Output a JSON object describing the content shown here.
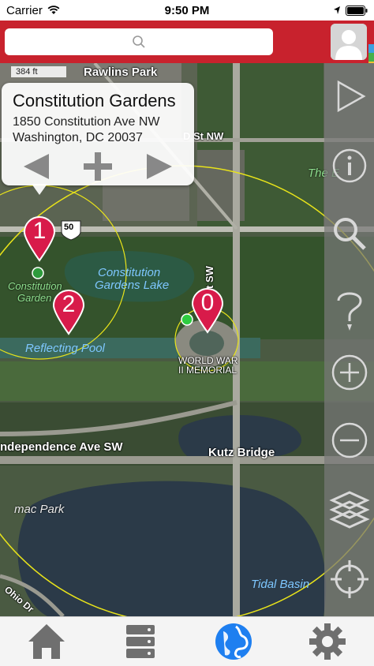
{
  "status_bar": {
    "carrier": "Carrier",
    "time": "9:50 PM"
  },
  "search": {
    "placeholder": ""
  },
  "map": {
    "scale_label": "384 ft",
    "labels": {
      "rawlins_park": "Rawlins Park",
      "d_st": "D St NW",
      "the_ellipse": "The E",
      "constitution_gardens_lake_1": "Constitution",
      "constitution_gardens_lake_2": "Gardens Lake",
      "constitution_garden_1": "Constitution",
      "constitution_garden_2": "Garden",
      "reflecting_pool": "Reflecting Pool",
      "seventeenth_st": "17th St SW",
      "wwii_1": "WORLD WAR",
      "wwii_2": "II MEMORIAL",
      "independence_ave": "ndependence Ave SW",
      "kutz_bridge": "Kutz Bridge",
      "potomac_park": "mac Park",
      "tidal_basin": "Tidal Basin",
      "ohio_dr": "Ohio Dr",
      "route_shield": "50"
    }
  },
  "info_card": {
    "title": "Constitution Gardens",
    "address_line1": "1850 Constitution Ave NW",
    "address_line2": "Washington, DC  20037"
  },
  "pins": [
    {
      "label": "1",
      "color": "#d81b4a"
    },
    {
      "label": "2",
      "color": "#d81b4a"
    },
    {
      "label": "0",
      "color": "#d81b4a"
    }
  ],
  "sidebar": {
    "buttons": [
      "play-icon",
      "info-icon",
      "magnifier-icon",
      "question-icon",
      "zoom-in-icon",
      "zoom-out-icon",
      "layers-icon",
      "locate-icon"
    ]
  },
  "tabbar": {
    "tabs": [
      "home-icon",
      "database-icon",
      "globe-icon",
      "gear-icon"
    ],
    "active_index": 2,
    "active_color": "#1e7ff0"
  },
  "colors": {
    "brand_red": "#c8222d",
    "pin_red": "#d81b4a",
    "ring_yellow": "#e8e31a"
  }
}
